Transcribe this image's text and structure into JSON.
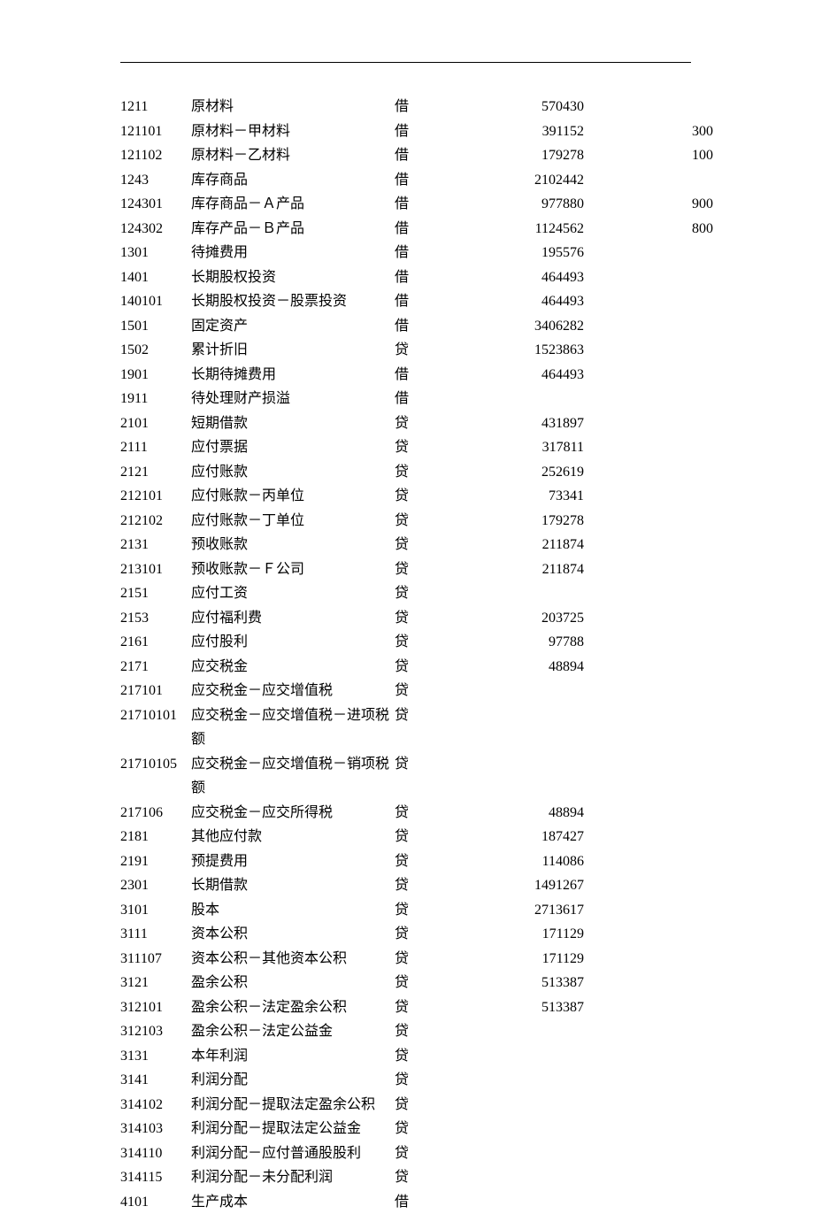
{
  "rows": [
    {
      "code": "1211",
      "name": "原材料",
      "dc": "借",
      "amount": "570430",
      "qty": ""
    },
    {
      "code": "121101",
      "name": "原材料－甲材料",
      "dc": "借",
      "amount": "391152",
      "qty": "300"
    },
    {
      "code": "121102",
      "name": "原材料－乙材料",
      "dc": "借",
      "amount": "179278",
      "qty": "100"
    },
    {
      "code": "1243",
      "name": "库存商品",
      "dc": "借",
      "amount": "2102442",
      "qty": ""
    },
    {
      "code": "124301",
      "name": "库存商品－Ａ产品",
      "dc": "借",
      "amount": "977880",
      "qty": "900"
    },
    {
      "code": "124302",
      "name": "库存产品－Ｂ产品",
      "dc": "借",
      "amount": "1124562",
      "qty": "800"
    },
    {
      "code": "1301",
      "name": "待摊费用",
      "dc": "借",
      "amount": "195576",
      "qty": ""
    },
    {
      "code": "1401",
      "name": "长期股权投资",
      "dc": "借",
      "amount": "464493",
      "qty": ""
    },
    {
      "code": "140101",
      "name": "长期股权投资－股票投资",
      "dc": "借",
      "amount": "464493",
      "qty": ""
    },
    {
      "code": "1501",
      "name": "固定资产",
      "dc": "借",
      "amount": "3406282",
      "qty": ""
    },
    {
      "code": "1502",
      "name": "累计折旧",
      "dc": "贷",
      "amount": "1523863",
      "qty": ""
    },
    {
      "code": "1901",
      "name": "长期待摊费用",
      "dc": "借",
      "amount": "464493",
      "qty": ""
    },
    {
      "code": "1911",
      "name": "待处理财产损溢",
      "dc": "借",
      "amount": "",
      "qty": ""
    },
    {
      "code": "2101",
      "name": "短期借款",
      "dc": "贷",
      "amount": "431897",
      "qty": ""
    },
    {
      "code": "2111",
      "name": "应付票据",
      "dc": "贷",
      "amount": "317811",
      "qty": ""
    },
    {
      "code": "2121",
      "name": "应付账款",
      "dc": "贷",
      "amount": "252619",
      "qty": ""
    },
    {
      "code": "212101",
      "name": "应付账款－丙单位",
      "dc": "贷",
      "amount": "73341",
      "qty": ""
    },
    {
      "code": "212102",
      "name": "应付账款－丁单位",
      "dc": "贷",
      "amount": "179278",
      "qty": ""
    },
    {
      "code": "2131",
      "name": "预收账款",
      "dc": "贷",
      "amount": "211874",
      "qty": ""
    },
    {
      "code": "213101",
      "name": "预收账款－Ｆ公司",
      "dc": "贷",
      "amount": "211874",
      "qty": ""
    },
    {
      "code": "2151",
      "name": "应付工资",
      "dc": "贷",
      "amount": "",
      "qty": ""
    },
    {
      "code": "2153",
      "name": "应付福利费",
      "dc": "贷",
      "amount": "203725",
      "qty": ""
    },
    {
      "code": "2161",
      "name": "应付股利",
      "dc": "贷",
      "amount": "97788",
      "qty": ""
    },
    {
      "code": "2171",
      "name": "应交税金",
      "dc": "贷",
      "amount": "48894",
      "qty": ""
    },
    {
      "code": "217101",
      "name": "应交税金－应交增值税",
      "dc": "贷",
      "amount": "",
      "qty": ""
    },
    {
      "code": "21710101",
      "name": "应交税金－应交增值税－进项税额",
      "dc": "贷",
      "amount": "",
      "qty": ""
    },
    {
      "code": "21710105",
      "name": "应交税金－应交增值税－销项税额",
      "dc": "贷",
      "amount": "",
      "qty": ""
    },
    {
      "code": "217106",
      "name": "应交税金－应交所得税",
      "dc": "贷",
      "amount": "48894",
      "qty": ""
    },
    {
      "code": "2181",
      "name": "其他应付款",
      "dc": "贷",
      "amount": "187427",
      "qty": ""
    },
    {
      "code": "2191",
      "name": "预提费用",
      "dc": "贷",
      "amount": "114086",
      "qty": ""
    },
    {
      "code": "2301",
      "name": "长期借款",
      "dc": "贷",
      "amount": "1491267",
      "qty": ""
    },
    {
      "code": "3101",
      "name": "股本",
      "dc": "贷",
      "amount": "2713617",
      "qty": ""
    },
    {
      "code": "3111",
      "name": "资本公积",
      "dc": "贷",
      "amount": "171129",
      "qty": ""
    },
    {
      "code": "311107",
      "name": "资本公积－其他资本公积",
      "dc": "贷",
      "amount": "171129",
      "qty": ""
    },
    {
      "code": "3121",
      "name": "盈余公积",
      "dc": "贷",
      "amount": "513387",
      "qty": ""
    },
    {
      "code": "312101",
      "name": "盈余公积－法定盈余公积",
      "dc": "贷",
      "amount": "513387",
      "qty": ""
    },
    {
      "code": "312103",
      "name": "盈余公积－法定公益金",
      "dc": "贷",
      "amount": "",
      "qty": ""
    },
    {
      "code": "3131",
      "name": "本年利润",
      "dc": "贷",
      "amount": "",
      "qty": ""
    },
    {
      "code": "3141",
      "name": "利润分配",
      "dc": "贷",
      "amount": "",
      "qty": ""
    },
    {
      "code": "314102",
      "name": "利润分配－提取法定盈余公积",
      "dc": "贷",
      "amount": "",
      "qty": ""
    },
    {
      "code": "314103",
      "name": "利润分配－提取法定公益金",
      "dc": "贷",
      "amount": "",
      "qty": ""
    },
    {
      "code": "314110",
      "name": "利润分配－应付普通股股利",
      "dc": "贷",
      "amount": "",
      "qty": ""
    },
    {
      "code": "314115",
      "name": "利润分配－未分配利润",
      "dc": "贷",
      "amount": "",
      "qty": ""
    },
    {
      "code": "4101",
      "name": "生产成本",
      "dc": "借",
      "amount": "",
      "qty": ""
    }
  ]
}
